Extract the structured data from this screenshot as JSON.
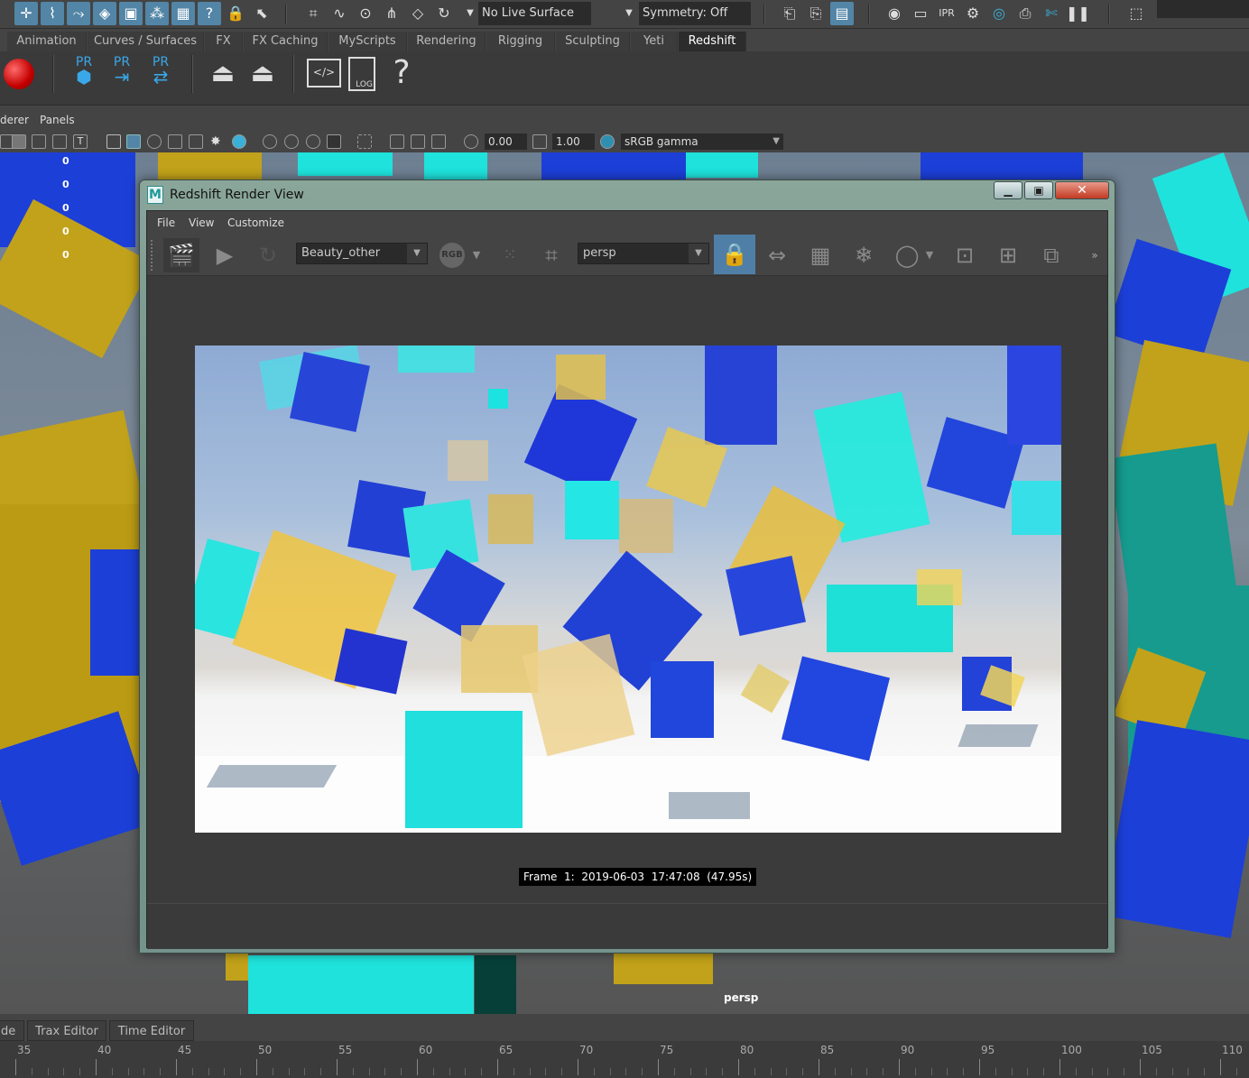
{
  "status_line": {
    "live_surface": "No Live Surface",
    "symmetry": "Symmetry: Off"
  },
  "shelf_tabs": [
    "Animation",
    "Curves / Surfaces",
    "FX",
    "FX Caching",
    "MyScripts",
    "Rendering",
    "Rigging",
    "Sculpting",
    "Yeti",
    "Redshift"
  ],
  "active_shelf_tab": "Redshift",
  "shelf": {
    "pr_label": "PR",
    "log_label": "LOG",
    "help_glyph": "?"
  },
  "panel_menu": {
    "renderer": "derer",
    "panels": "Panels"
  },
  "panel_toolbar": {
    "exposure": "0.00",
    "gamma": "1.00",
    "colorspace": "sRGB gamma"
  },
  "hud_counts": [
    "0",
    "0",
    "0",
    "0",
    "0"
  ],
  "viewport": {
    "camera_label": "persp"
  },
  "render_view": {
    "title": "Redshift Render View",
    "menu": [
      "File",
      "View",
      "Customize"
    ],
    "aov": "Beauty_other",
    "rgb_label": "RGB",
    "camera": "persp",
    "frame_info": "Frame  1:  2019-06-03  17:47:08  (47.95s)",
    "overflow": "»"
  },
  "bottom_tabs": [
    "de",
    "Trax Editor",
    "Time Editor"
  ],
  "timeline": {
    "labels": [
      "35",
      "40",
      "45",
      "50",
      "55",
      "60",
      "65",
      "70",
      "75",
      "80",
      "85",
      "90",
      "95",
      "100",
      "105",
      "110"
    ]
  },
  "colors": {
    "cube_yellow": "#c2a21a",
    "cube_blue": "#1c3fd8",
    "cube_cyan": "#1fe2dc",
    "cube_teal": "#169b8e",
    "active_blue": "#5285a6"
  }
}
